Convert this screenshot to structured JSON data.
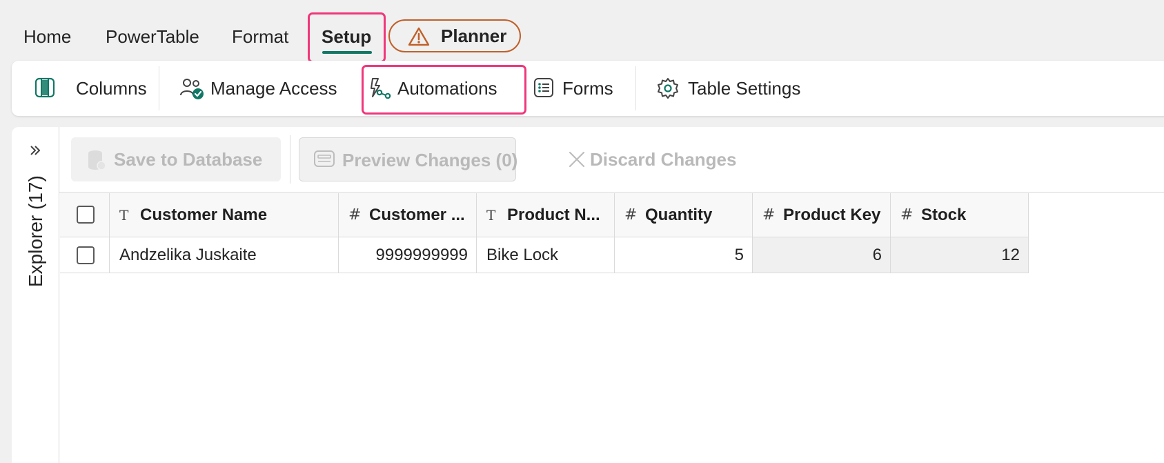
{
  "menu": {
    "tabs": [
      "Home",
      "PowerTable",
      "Format",
      "Setup"
    ],
    "planner_label": "Planner",
    "active_tab": "Setup"
  },
  "ribbon": {
    "columns": "Columns",
    "manage_access": "Manage Access",
    "automations": "Automations",
    "forms": "Forms",
    "table_settings": "Table Settings"
  },
  "explorer": {
    "label": "Explorer (17)"
  },
  "toolbar": {
    "save": "Save to Database",
    "preview": "Preview Changes (0)",
    "discard": "Discard Changes"
  },
  "table": {
    "headers": [
      {
        "type": "T",
        "label": "Customer Name"
      },
      {
        "type": "#",
        "label": "Customer ..."
      },
      {
        "type": "T",
        "label": "Product N..."
      },
      {
        "type": "#",
        "label": "Quantity"
      },
      {
        "type": "#",
        "label": "Product Key"
      },
      {
        "type": "#",
        "label": "Stock"
      }
    ],
    "rows": [
      [
        "Andzelika Juskaite",
        "9999999999",
        "Bike Lock",
        "5",
        "6",
        "12"
      ]
    ]
  },
  "colors": {
    "accent": "#117865",
    "highlight": "#f0367a",
    "planner_border": "#c0602a",
    "disabled_text": "#b9b9b9"
  },
  "icons": {
    "planner": "warning-triangle-icon",
    "columns": "columns-icon",
    "manage_access": "people-check-icon",
    "automations": "flow-icon",
    "forms": "form-list-icon",
    "table_settings": "gear-icon",
    "save": "database-icon",
    "preview": "preview-icon",
    "discard": "close-icon",
    "explorer": "chevron-double-right-icon"
  }
}
